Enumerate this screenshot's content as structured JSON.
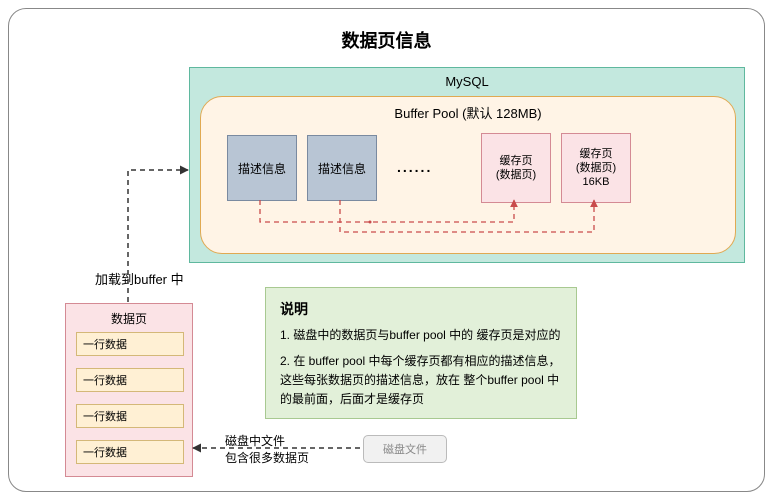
{
  "title": "数据页信息",
  "mysql": {
    "label": "MySQL",
    "bufferpool": {
      "label": "Buffer Pool   (默认 128MB)",
      "desc1": "描述信息",
      "desc2": "描述信息",
      "dots": "......",
      "cache1": "缓存页\n(数据页)",
      "cache2": "缓存页\n(数据页)\n16KB"
    }
  },
  "loadtext": "加载到buffer 中",
  "datapage": {
    "label": "数据页",
    "row1": "一行数据",
    "row2": "一行数据",
    "row3": "一行数据",
    "row4": "一行数据"
  },
  "explain": {
    "title": "说明",
    "p1": "1. 磁盘中的数据页与buffer pool 中的 缓存页是对应的",
    "p2": "2. 在 buffer pool 中每个缓存页都有相应的描述信息，这些每张数据页的描述信息，放在 整个buffer pool 中的最前面，后面才是缓存页"
  },
  "diskfile": "磁盘文件",
  "disktext": "磁盘中文件\n包含很多数据页"
}
